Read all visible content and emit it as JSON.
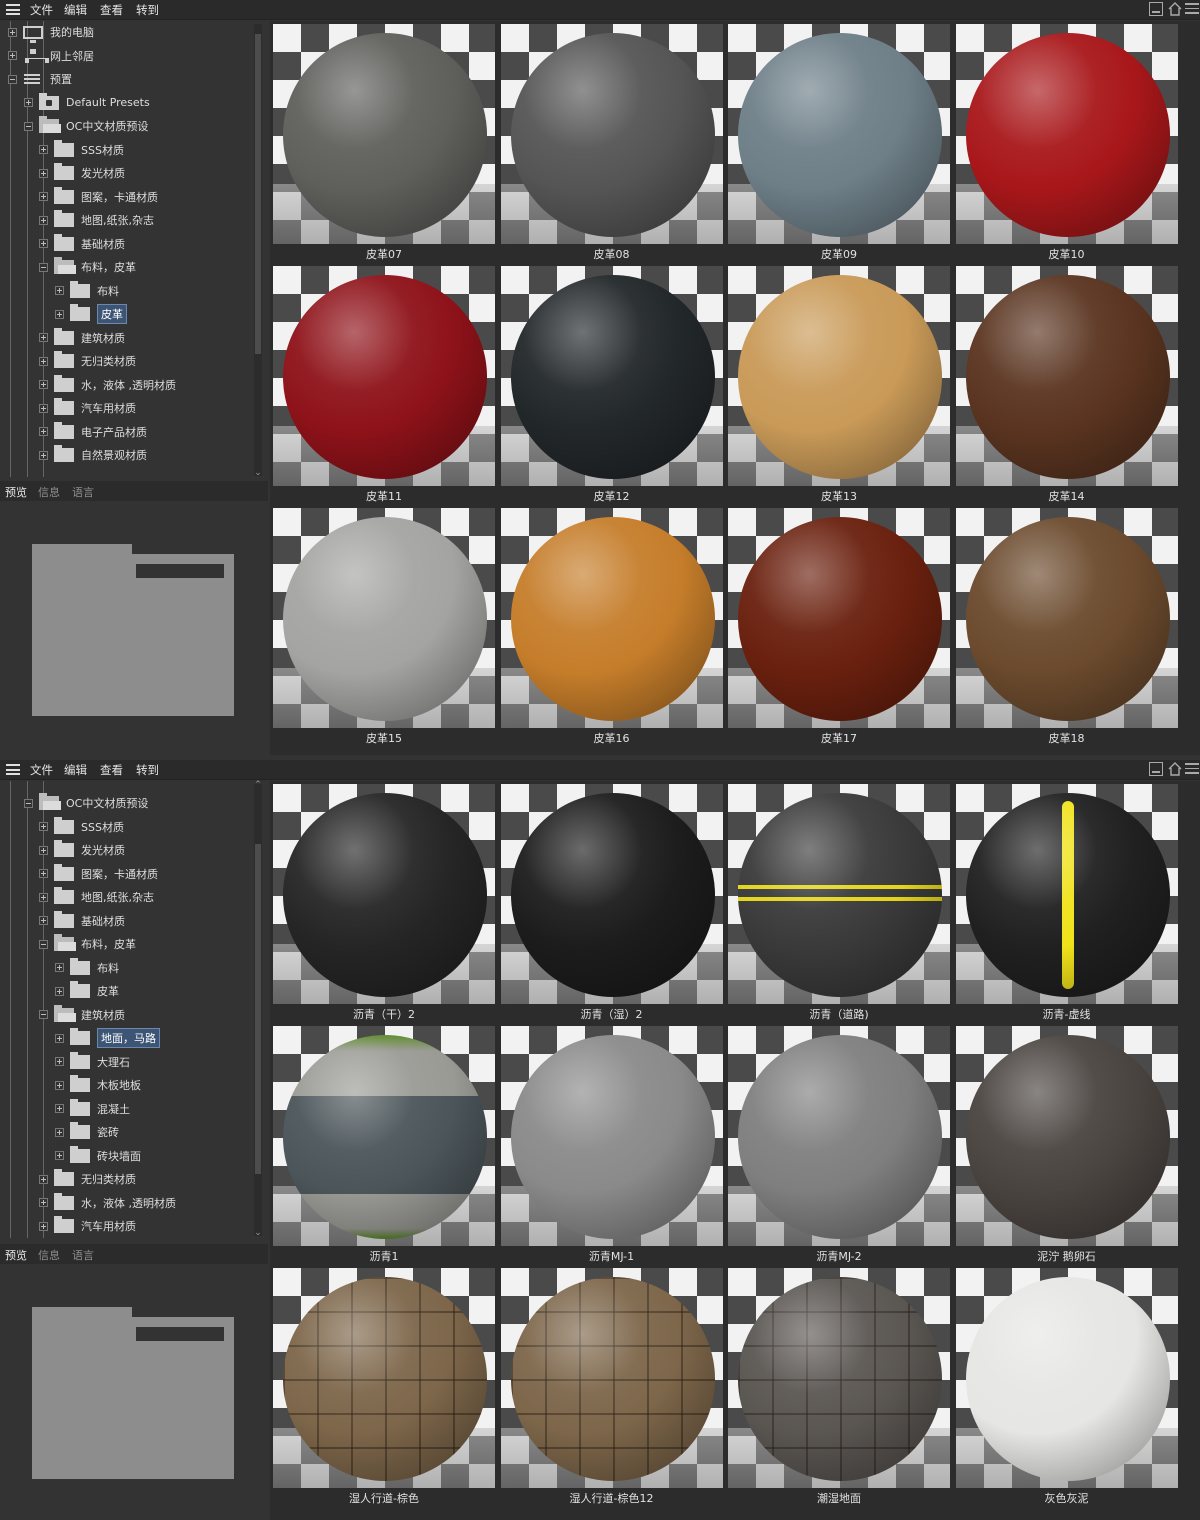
{
  "menu": {
    "file": "文件",
    "edit": "编辑",
    "view": "查看",
    "goto": "转到"
  },
  "tabs": {
    "preview": "预览",
    "info": "信息",
    "language": "语言"
  },
  "panel1": {
    "tree": [
      {
        "label": "我的电脑",
        "icon": "computer-icon",
        "level": 0,
        "exp": "plus"
      },
      {
        "label": "网上邻居",
        "icon": "network-icon",
        "level": 0,
        "exp": "plus"
      },
      {
        "label": "预置",
        "icon": "presets-icon",
        "level": 0,
        "exp": "minus"
      },
      {
        "label": "Default Presets",
        "icon": "locked-folder-icon",
        "level": 1,
        "exp": "plus"
      },
      {
        "label": "OC中文材质预设",
        "icon": "open-folder-icon",
        "level": 1,
        "exp": "minus"
      },
      {
        "label": "SSS材质",
        "icon": "folder-icon",
        "level": 2,
        "exp": "plus"
      },
      {
        "label": "发光材质",
        "icon": "folder-icon",
        "level": 2,
        "exp": "plus"
      },
      {
        "label": "图案，卡通材质",
        "icon": "folder-icon",
        "level": 2,
        "exp": "plus"
      },
      {
        "label": "地图,纸张,杂志",
        "icon": "folder-icon",
        "level": 2,
        "exp": "plus"
      },
      {
        "label": "基础材质",
        "icon": "folder-icon",
        "level": 2,
        "exp": "plus"
      },
      {
        "label": "布料，皮革",
        "icon": "open-folder-icon",
        "level": 2,
        "exp": "minus"
      },
      {
        "label": "布料",
        "icon": "folder-icon",
        "level": 3,
        "exp": "plus"
      },
      {
        "label": "皮革",
        "icon": "folder-icon",
        "level": 3,
        "exp": "plus",
        "selected": true
      },
      {
        "label": "建筑材质",
        "icon": "folder-icon",
        "level": 2,
        "exp": "plus"
      },
      {
        "label": "无归类材质",
        "icon": "folder-icon",
        "level": 2,
        "exp": "plus"
      },
      {
        "label": "水，液体 ,透明材质",
        "icon": "folder-icon",
        "level": 2,
        "exp": "plus"
      },
      {
        "label": "汽车用材质",
        "icon": "folder-icon",
        "level": 2,
        "exp": "plus"
      },
      {
        "label": "电子产品材质",
        "icon": "folder-icon",
        "level": 2,
        "exp": "plus"
      },
      {
        "label": "自然景观材质",
        "icon": "folder-icon",
        "level": 2,
        "exp": "plus"
      }
    ],
    "materials": [
      {
        "name": "皮革07",
        "color": "#5f5f5c"
      },
      {
        "name": "皮革08",
        "color": "#555555"
      },
      {
        "name": "皮革09",
        "color": "#6e7f88"
      },
      {
        "name": "皮革10",
        "color": "#a8171a"
      },
      {
        "name": "皮革11",
        "color": "#8e1219"
      },
      {
        "name": "皮革12",
        "color": "#22272a"
      },
      {
        "name": "皮革13",
        "color": "#c99a58"
      },
      {
        "name": "皮革14",
        "color": "#5a3420"
      },
      {
        "name": "皮革15",
        "color": "#a4a4a2"
      },
      {
        "name": "皮革16",
        "color": "#c57d2a"
      },
      {
        "name": "皮革17",
        "color": "#6a200e"
      },
      {
        "name": "皮革18",
        "color": "#6b4a2d"
      }
    ]
  },
  "panel2": {
    "tree": [
      {
        "label": "OC中文材质预设",
        "icon": "open-folder-icon",
        "level": 1,
        "exp": "minus"
      },
      {
        "label": "SSS材质",
        "icon": "folder-icon",
        "level": 2,
        "exp": "plus"
      },
      {
        "label": "发光材质",
        "icon": "folder-icon",
        "level": 2,
        "exp": "plus"
      },
      {
        "label": "图案，卡通材质",
        "icon": "folder-icon",
        "level": 2,
        "exp": "plus"
      },
      {
        "label": "地图,纸张,杂志",
        "icon": "folder-icon",
        "level": 2,
        "exp": "plus"
      },
      {
        "label": "基础材质",
        "icon": "folder-icon",
        "level": 2,
        "exp": "plus"
      },
      {
        "label": "布料，皮革",
        "icon": "open-folder-icon",
        "level": 2,
        "exp": "minus"
      },
      {
        "label": "布料",
        "icon": "folder-icon",
        "level": 3,
        "exp": "plus"
      },
      {
        "label": "皮革",
        "icon": "folder-icon",
        "level": 3,
        "exp": "plus"
      },
      {
        "label": "建筑材质",
        "icon": "open-folder-icon",
        "level": 2,
        "exp": "minus"
      },
      {
        "label": "地面，马路",
        "icon": "folder-icon",
        "level": 3,
        "exp": "plus",
        "selected": true
      },
      {
        "label": "大理石",
        "icon": "folder-icon",
        "level": 3,
        "exp": "plus"
      },
      {
        "label": "木板地板",
        "icon": "folder-icon",
        "level": 3,
        "exp": "plus"
      },
      {
        "label": "混凝土",
        "icon": "folder-icon",
        "level": 3,
        "exp": "plus"
      },
      {
        "label": "瓷砖",
        "icon": "folder-icon",
        "level": 3,
        "exp": "plus"
      },
      {
        "label": "砖块墙面",
        "icon": "folder-icon",
        "level": 3,
        "exp": "plus"
      },
      {
        "label": "无归类材质",
        "icon": "folder-icon",
        "level": 2,
        "exp": "plus"
      },
      {
        "label": "水，液体 ,透明材质",
        "icon": "folder-icon",
        "level": 2,
        "exp": "plus"
      },
      {
        "label": "汽车用材质",
        "icon": "folder-icon",
        "level": 2,
        "exp": "plus"
      }
    ],
    "materials": [
      {
        "name": "沥青（干）2",
        "color": "#252525"
      },
      {
        "name": "沥青（湿）2",
        "color": "#1c1c1c"
      },
      {
        "name": "沥青（道路)",
        "color": "#3a3a3a",
        "style": "hstripe"
      },
      {
        "name": "沥青-虚线",
        "color": "#202020",
        "style": "vstripe"
      },
      {
        "name": "沥青1",
        "color": "#4b555a",
        "style": "bands"
      },
      {
        "name": "沥青MJ-1",
        "color": "#8a8a8a"
      },
      {
        "name": "沥青MJ-2",
        "color": "#7f7f7f"
      },
      {
        "name": "泥泞 鹅卵石",
        "color": "#4a4440"
      },
      {
        "name": "湿人行道-棕色",
        "color": "#7d664a",
        "style": "tiles"
      },
      {
        "name": "湿人行道-棕色12",
        "color": "#7d664a",
        "style": "tiles"
      },
      {
        "name": "潮湿地面",
        "color": "#5a5652",
        "style": "tiles"
      },
      {
        "name": "灰色灰泥",
        "color": "#e6e6e4"
      }
    ]
  }
}
